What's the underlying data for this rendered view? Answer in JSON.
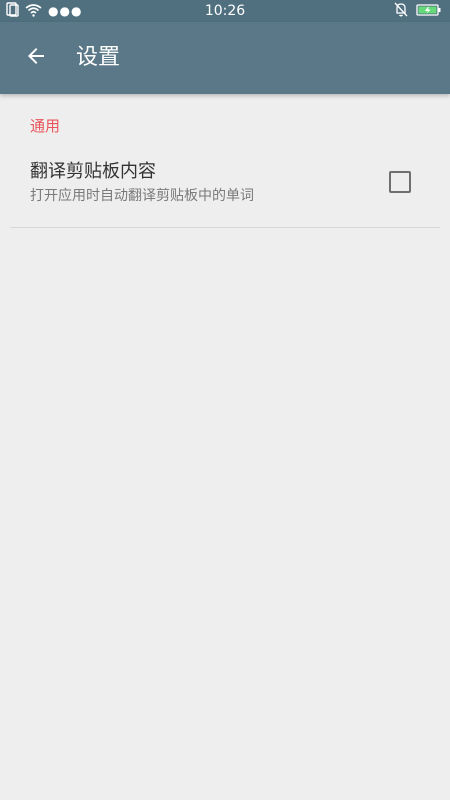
{
  "status_bar": {
    "time": "10:26",
    "left_icons": [
      "sim-card-icon",
      "wifi-icon",
      "more-dots-icon"
    ],
    "right_icons": [
      "notifications-off-icon",
      "battery-charging-icon"
    ],
    "battery_color": "#66d97a"
  },
  "app_bar": {
    "back_icon": "arrow-left-icon",
    "title": "设置",
    "color": "#5a7888"
  },
  "settings": {
    "section_header": "通用",
    "section_header_color": "#e8555b",
    "items": [
      {
        "title": "翻译剪贴板内容",
        "summary": "打开应用时自动翻译剪贴板中的单词",
        "checked": false
      }
    ]
  }
}
